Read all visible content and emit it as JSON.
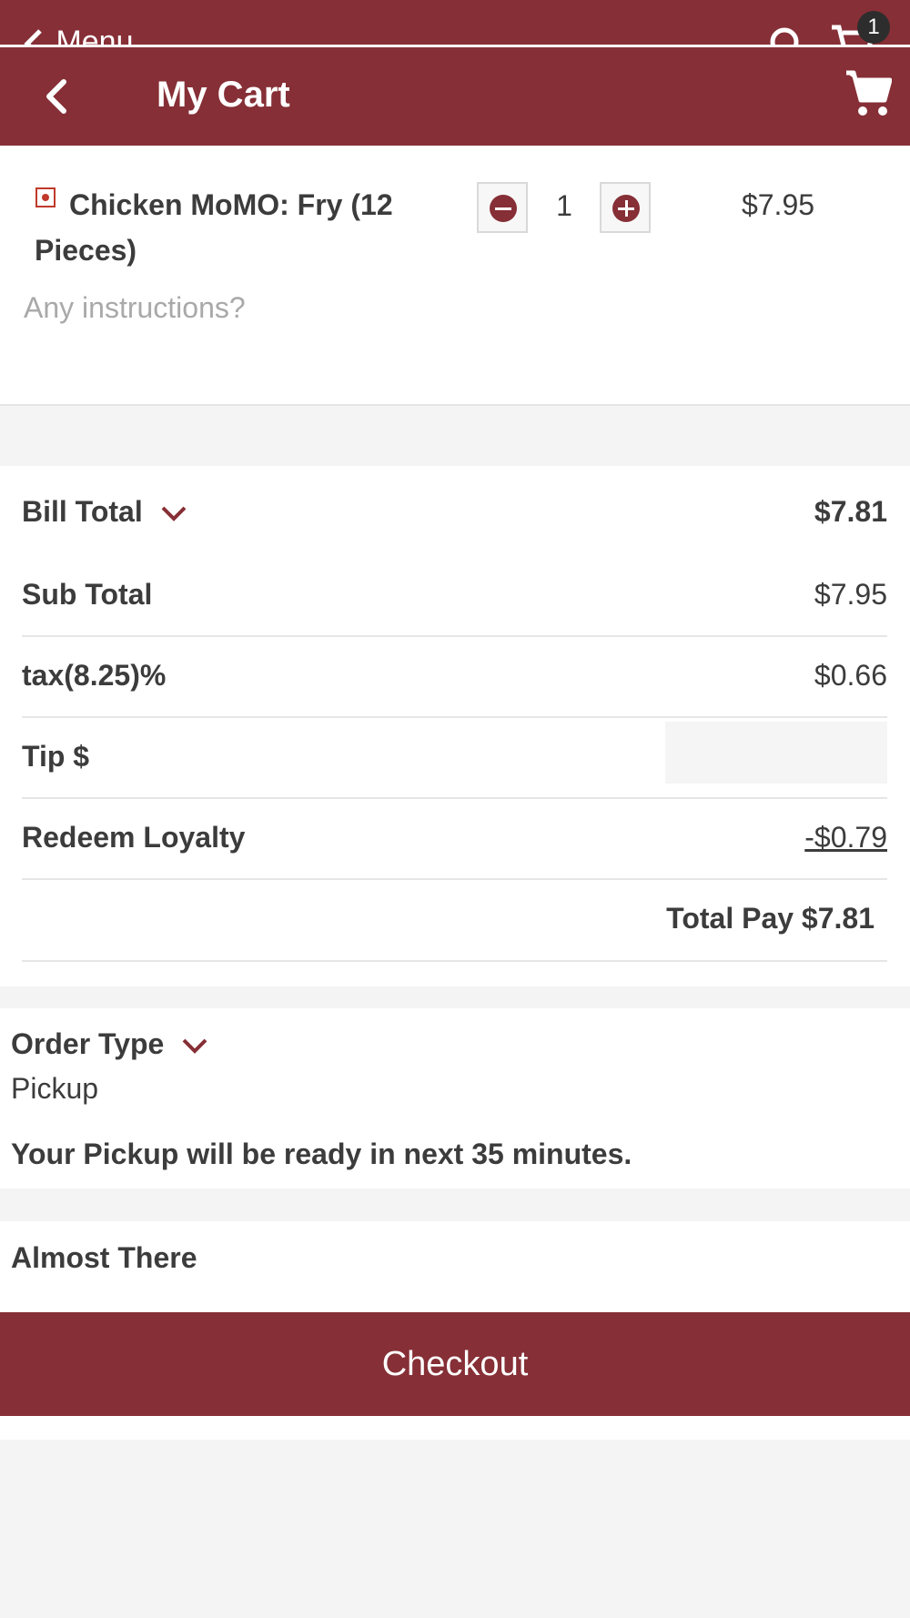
{
  "background_bar": {
    "back_label": "Menu",
    "cart_badge": "1"
  },
  "header": {
    "title": "My Cart"
  },
  "cart_item": {
    "name": "Chicken MoMO: Fry (12 Pieces)",
    "quantity": "1",
    "price": "$7.95",
    "instructions_placeholder": "Any instructions?"
  },
  "bill": {
    "bill_total_label": "Bill Total",
    "bill_total_value": "$7.81",
    "subtotal_label": "Sub Total",
    "subtotal_value": "$7.95",
    "tax_label": "tax(8.25)%",
    "tax_value": "$0.66",
    "tip_label": "Tip $",
    "tip_value": "",
    "loyalty_label": "Redeem Loyalty",
    "loyalty_value": "-$0.79",
    "total_pay": "Total Pay $7.81"
  },
  "order_type": {
    "title": "Order Type",
    "value": "Pickup",
    "message": "Your Pickup will be ready in next 35 minutes."
  },
  "status": {
    "almost_there": "Almost There"
  },
  "actions": {
    "checkout_label": "Checkout"
  },
  "colors": {
    "brand": "#862f36",
    "link": "#2f6fe6",
    "veg_mark": "#c0392b"
  },
  "icons": [
    "chevron-left-icon",
    "search-icon",
    "cart-icon",
    "minus-icon",
    "plus-icon",
    "chevron-down-icon"
  ]
}
